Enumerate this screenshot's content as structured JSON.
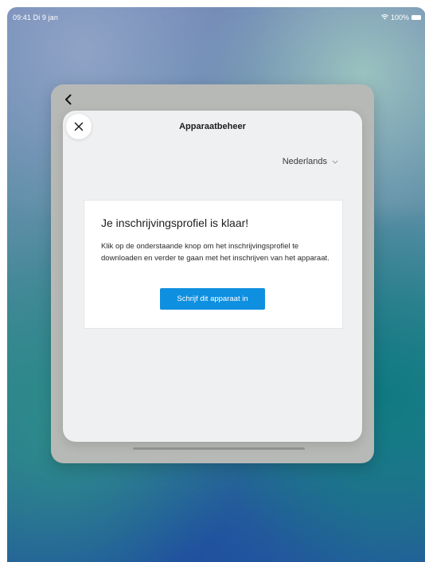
{
  "status_bar": {
    "time_date": "09:41  Di 9 jan",
    "battery": "100%",
    "wifi_icon": "wifi-icon",
    "battery_icon": "battery-icon"
  },
  "nav": {
    "back_icon": "back-chevron-icon"
  },
  "modal": {
    "close_icon": "close-icon",
    "title": "Apparaatbeheer",
    "language": {
      "selected": "Nederlands",
      "icon": "chevron-down-icon"
    },
    "card": {
      "heading": "Je inschrijvingsprofiel is klaar!",
      "body": "Klik op de onderstaande knop om het inschrijvingsprofiel te downloaden en verder te gaan met het inschrijven van het apparaat.",
      "button_label": "Schrijf dit apparaat in"
    }
  },
  "colors": {
    "primary_button": "#0f8fe0",
    "modal_background": "#eef0f2",
    "card_background": "#ffffff"
  }
}
